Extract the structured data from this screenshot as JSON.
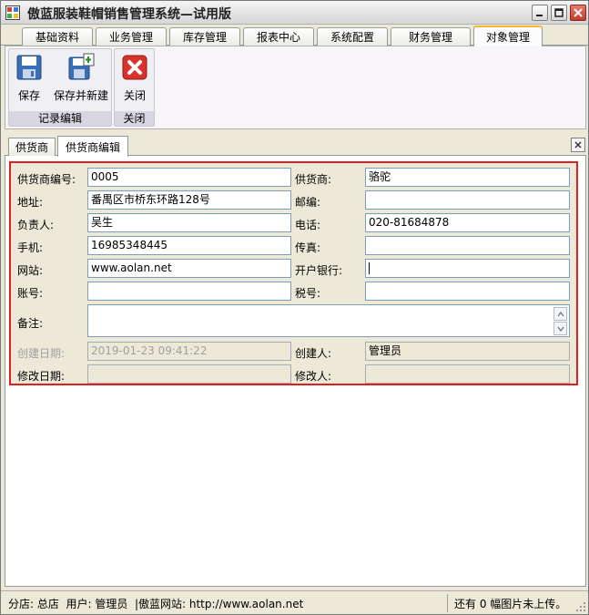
{
  "window": {
    "title": "傲蓝服装鞋帽销售管理系统—试用版"
  },
  "menu_tabs": [
    "基础资料",
    "业务管理",
    "库存管理",
    "报表中心",
    "系统配置",
    "财务管理",
    "对象管理"
  ],
  "menu_active": "对象管理",
  "ribbon": {
    "groups": [
      {
        "label": "记录编辑",
        "buttons": [
          {
            "label": "保存",
            "icon": "save-icon"
          },
          {
            "label": "保存并新建",
            "icon": "save-new-icon"
          }
        ]
      },
      {
        "label": "关闭",
        "buttons": [
          {
            "label": "关闭",
            "icon": "close-red-icon"
          }
        ]
      }
    ]
  },
  "doc_tabs": [
    "供货商",
    "供货商编辑"
  ],
  "doc_active": "供货商编辑",
  "form": {
    "supplier_no": {
      "label": "供货商编号:",
      "value": "0005"
    },
    "supplier": {
      "label": "供货商:",
      "value": "骆驼"
    },
    "address": {
      "label": "地址:",
      "value": "番禺区市桥东环路128号"
    },
    "postcode": {
      "label": "邮编:",
      "value": ""
    },
    "contact": {
      "label": "负责人:",
      "value": "吴生"
    },
    "phone": {
      "label": "电话:",
      "value": "020-81684878"
    },
    "mobile": {
      "label": "手机:",
      "value": "16985348445"
    },
    "fax": {
      "label": "传真:",
      "value": ""
    },
    "website": {
      "label": "网站:",
      "value": "www.aolan.net"
    },
    "bank": {
      "label": "开户银行:",
      "value": ""
    },
    "account": {
      "label": "账号:",
      "value": ""
    },
    "tax_no": {
      "label": "税号:",
      "value": ""
    },
    "remark": {
      "label": "备注:",
      "value": ""
    },
    "created_date": {
      "label": "创建日期:",
      "value": "2019-01-23 09:41:22"
    },
    "creator": {
      "label": "创建人:",
      "value": "管理员"
    },
    "modified_date": {
      "label": "修改日期:",
      "value": ""
    },
    "modifier": {
      "label": "修改人:",
      "value": ""
    }
  },
  "status": {
    "left": "分店: 总店  用户: 管理员  |傲蓝网站: http://www.aolan.net",
    "right": "还有 0 幅图片未上传。"
  },
  "colors": {
    "highlight_border": "#e02020",
    "active_tab_accent": "#f9b233"
  }
}
